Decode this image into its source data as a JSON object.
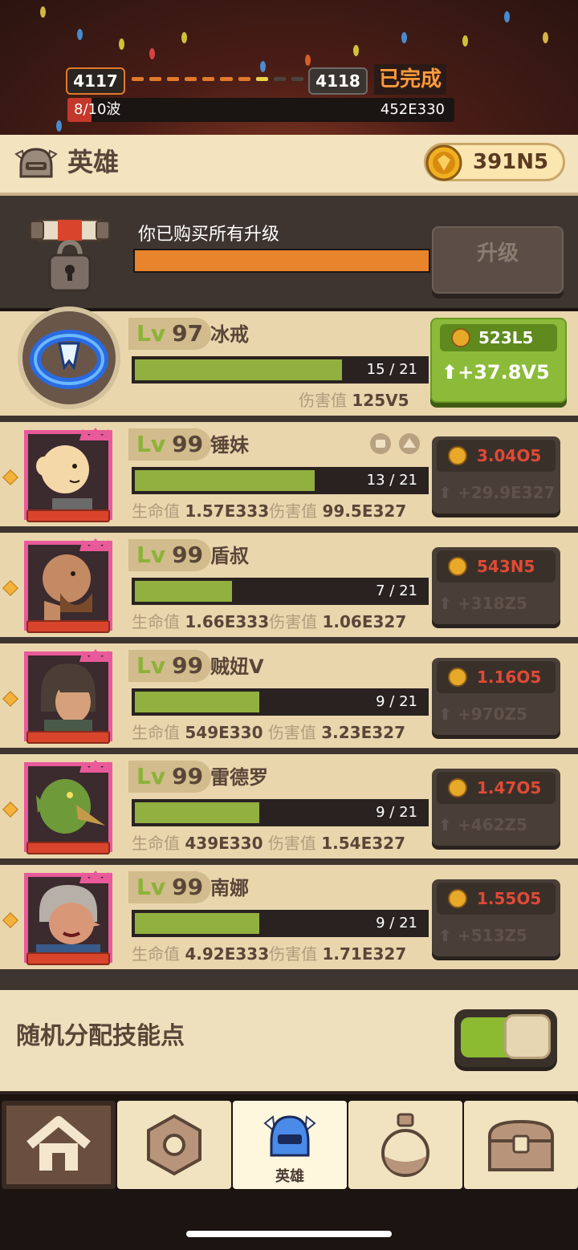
{
  "stage": {
    "current_level": "4117",
    "next_level": "4118",
    "status": "已完成",
    "wave_text": "8/10波",
    "wave_progress": 0.8,
    "enemy_hp": "452E330"
  },
  "header": {
    "title": "英雄",
    "coins": "391N5"
  },
  "upgrade": {
    "message": "你已购买所有升级",
    "button_label": "升级",
    "progress": 1.0
  },
  "heroes": [
    {
      "level_prefix": "Lv",
      "level": "97",
      "name": "冰戒",
      "progress_text": "15 / 21",
      "progress": 0.714,
      "damage_label": "伤害值",
      "damage": "125V5",
      "cost": "523L5",
      "gain": "+37.8V5"
    },
    {
      "level_prefix": "Lv",
      "level": "99",
      "name": "锤妹",
      "progress_text": "13 / 21",
      "progress": 0.619,
      "hp_label": "生命值",
      "hp": "1.57E333",
      "damage_label": "伤害值",
      "damage": "99.5E327",
      "cost": "3.04O5",
      "gain": "+29.9E327"
    },
    {
      "level_prefix": "Lv",
      "level": "99",
      "name": "盾叔",
      "progress_text": "7 / 21",
      "progress": 0.333,
      "hp_label": "生命值",
      "hp": "1.66E333",
      "damage_label": "伤害值",
      "damage": "1.06E327",
      "cost": "543N5",
      "gain": "+318Z5"
    },
    {
      "level_prefix": "Lv",
      "level": "99",
      "name": "贼妞V",
      "progress_text": "9 / 21",
      "progress": 0.428,
      "hp_label": "生命值",
      "hp": "549E330",
      "damage_label": "伤害值",
      "damage": "3.23E327",
      "cost": "1.16O5",
      "gain": "+970Z5"
    },
    {
      "level_prefix": "Lv",
      "level": "99",
      "name": "雷德罗",
      "progress_text": "9 / 21",
      "progress": 0.428,
      "hp_label": "生命值",
      "hp": "439E330",
      "damage_label": "伤害值",
      "damage": "1.54E327",
      "cost": "1.47O5",
      "gain": "+462Z5"
    },
    {
      "level_prefix": "Lv",
      "level": "99",
      "name": "南娜",
      "progress_text": "9 / 21",
      "progress": 0.428,
      "hp_label": "生命值",
      "hp": "4.92E333",
      "damage_label": "伤害值",
      "damage": "1.71E327",
      "cost": "1.55O5",
      "gain": "+513Z5"
    }
  ],
  "random_assign": {
    "label": "随机分配技能点",
    "enabled": true
  },
  "nav": {
    "items": [
      {
        "id": "home",
        "icon": "house-icon",
        "label": ""
      },
      {
        "id": "gear",
        "icon": "gear-nut-icon",
        "label": ""
      },
      {
        "id": "heroes",
        "icon": "knight-helmet-icon",
        "label": "英雄",
        "active": true
      },
      {
        "id": "potion",
        "icon": "potion-flask-icon",
        "label": ""
      },
      {
        "id": "chest",
        "icon": "treasure-chest-icon",
        "label": ""
      }
    ]
  },
  "colors": {
    "accent_orange": "#e8842c",
    "xp_green": "#92b040",
    "buy_green": "#8cbb3a",
    "cost_red": "#e04a36",
    "portrait_pink": "#e85a9a"
  }
}
